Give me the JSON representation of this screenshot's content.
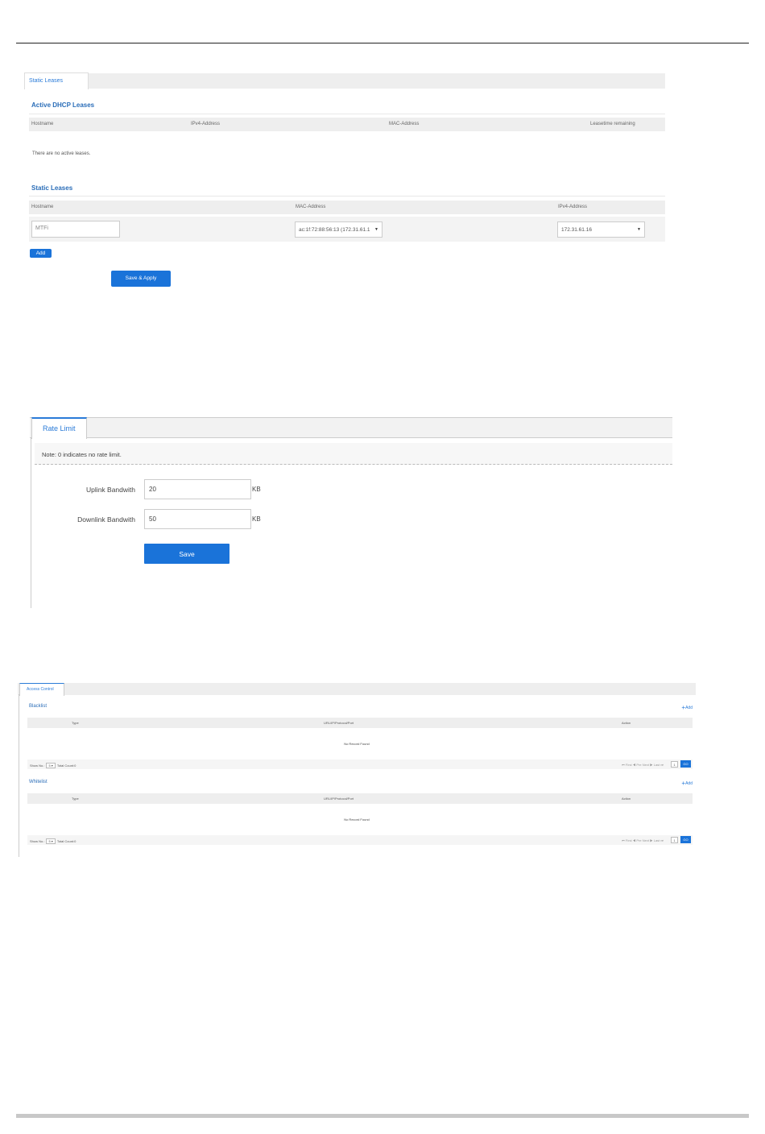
{
  "static_leases_panel": {
    "tab_label": "Static Leases",
    "active_section_title": "Active DHCP Leases",
    "active_columns": [
      "Hostname",
      "IPv4-Address",
      "MAC-Address",
      "Leasetime remaining"
    ],
    "active_empty_text": "There are no active leases.",
    "static_section_title": "Static Leases",
    "static_columns": [
      "Hostname",
      "MAC-Address",
      "IPv4-Address"
    ],
    "row": {
      "hostname_value": "MTFi",
      "mac_value": "ac:1f:72:88:56:13 (172.31.61.1",
      "ipv4_value": "172.31.61.16"
    },
    "add_label": "Add",
    "save_apply_label": "Save & Apply"
  },
  "rate_limit_panel": {
    "tab_label": "Rate Limit",
    "note": "Note: 0 indicates no rate limit.",
    "uplink_label": "Uplink Bandwith",
    "uplink_value": "20",
    "downlink_label": "Downlink Bandwith",
    "downlink_value": "50",
    "unit": "KB",
    "save_label": "Save"
  },
  "access_control_panel": {
    "tab_label": "Access Control",
    "blacklist": {
      "title": "Blacklist",
      "add_label": "Add",
      "columns": [
        "Type",
        "URL/IP/Protocol/Port",
        "Action"
      ],
      "empty_text": "No Record Found",
      "show_no_label": "Show No.:",
      "show_no_value": "5",
      "total_count": "Total Count:0",
      "nav": "⏮ First  ◀ Pre  Next ▶  Last ⏭",
      "page_value": "1",
      "go_label": "GO"
    },
    "whitelist": {
      "title": "Whitelist",
      "add_label": "Add",
      "columns": [
        "Type",
        "URL/IP/Protocol/Port",
        "Action"
      ],
      "empty_text": "No Record Found",
      "show_no_label": "Show No.:",
      "show_no_value": "5",
      "total_count": "Total Count:0",
      "nav": "⏮ First  ◀ Pre  Next ▶  Last ⏭",
      "page_value": "1",
      "go_label": "GO"
    }
  },
  "colors": {
    "accent": "#1a73d9",
    "section_title": "#2a6db8"
  }
}
